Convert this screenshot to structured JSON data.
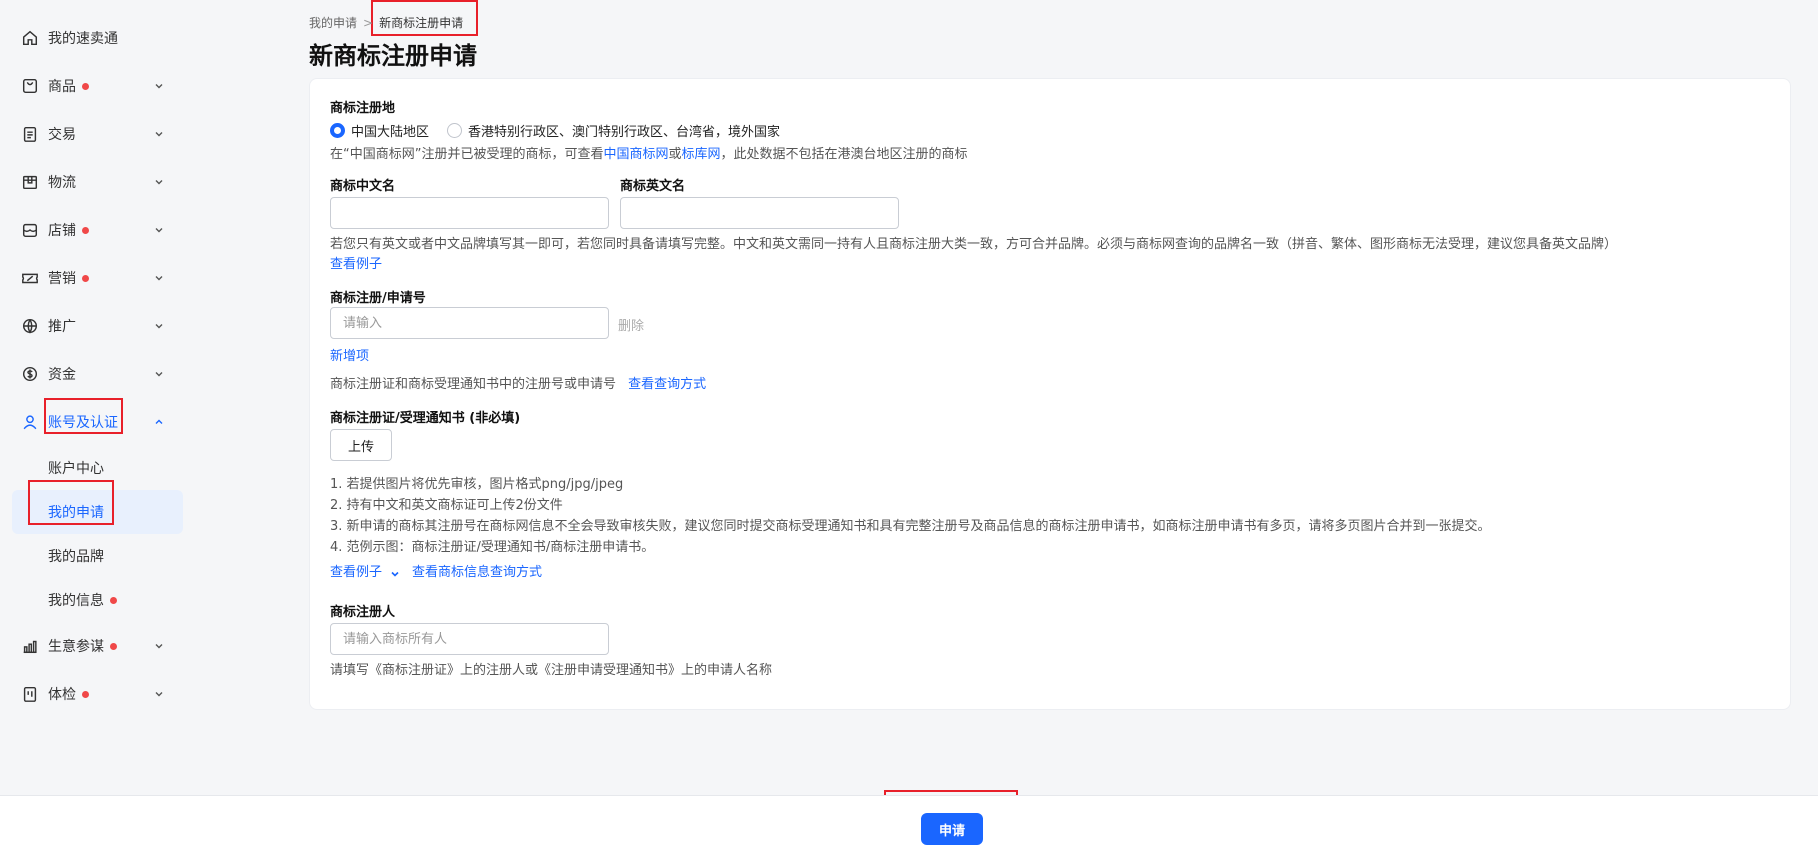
{
  "sidebar": {
    "items": [
      {
        "label": "我的速卖通",
        "icon": "home-icon",
        "dot": false,
        "chevron": false
      },
      {
        "label": "商品",
        "icon": "bag-icon",
        "dot": true,
        "chevron": true
      },
      {
        "label": "交易",
        "icon": "clipboard-icon",
        "dot": false,
        "chevron": true
      },
      {
        "label": "物流",
        "icon": "box-icon",
        "dot": false,
        "chevron": true
      },
      {
        "label": "店铺",
        "icon": "store-icon",
        "dot": true,
        "chevron": true
      },
      {
        "label": "营销",
        "icon": "ticket-icon",
        "dot": true,
        "chevron": true
      },
      {
        "label": "推广",
        "icon": "globe-icon",
        "dot": false,
        "chevron": true
      },
      {
        "label": "资金",
        "icon": "dollar-icon",
        "dot": false,
        "chevron": true
      },
      {
        "label": "账号及认证",
        "icon": "user-icon",
        "dot": false,
        "chevron": true,
        "expanded": true
      }
    ],
    "sub_items": [
      {
        "label": "账户中心",
        "dot": false
      },
      {
        "label": "我的申请",
        "dot": false,
        "selected": true
      },
      {
        "label": "我的品牌",
        "dot": false
      },
      {
        "label": "我的信息",
        "dot": true
      }
    ],
    "items_after": [
      {
        "label": "生意参谋",
        "icon": "chart-icon",
        "dot": true,
        "chevron": true
      },
      {
        "label": "体检",
        "icon": "report-icon",
        "dot": true,
        "chevron": true
      }
    ]
  },
  "breadcrumb": {
    "parent": "我的申请",
    "separator": ">",
    "current": "新商标注册申请"
  },
  "page_title": "新商标注册申请",
  "form": {
    "region": {
      "label": "商标注册地",
      "options": [
        "中国大陆地区",
        "香港特别行政区、澳门特别行政区、台湾省，境外国家"
      ],
      "selected_index": 0,
      "help_prefix": "在“中国商标网”注册并已被受理的商标，可查看",
      "help_link1": "中国商标网",
      "help_or": "或",
      "help_link2": "标库网",
      "help_suffix": "，此处数据不包括在港澳台地区注册的商标"
    },
    "cn_name": {
      "label": "商标中文名",
      "value": "",
      "placeholder": ""
    },
    "en_name": {
      "label": "商标英文名",
      "value": "",
      "placeholder": ""
    },
    "name_help": "若您只有英文或者中文品牌填写其一即可，若您同时具备请填写完整。中文和英文需同一持有人且商标注册大类一致，方可合并品牌。必须与商标网查询的品牌名一致（拼音、繁体、图形商标无法受理，建议您具备英文品牌）",
    "name_example_link": "查看例子",
    "reg_no": {
      "label": "商标注册/申请号",
      "placeholder": "请输入",
      "value": "",
      "delete_label": "删除",
      "add_label": "新增项",
      "help": "商标注册证和商标受理通知书中的注册号或申请号",
      "help_link": "查看查询方式"
    },
    "certificate": {
      "label": "商标注册证/受理通知书 (非必填)",
      "upload_label": "上传",
      "notes": [
        "1. 若提供图片将优先审核，图片格式png/jpg/jpeg",
        "2. 持有中文和英文商标证可上传2份文件",
        "3. 新申请的商标其注册号在商标网信息不全会导致审核失败，建议您同时提交商标受理通知书和具有完整注册号及商品信息的商标注册申请书，如商标注册申请书有多页，请将多页图片合并到一张提交。",
        "4. 范例示图：商标注册证/受理通知书/商标注册申请书。"
      ],
      "example_link": "查看例子",
      "query_link": "查看商标信息查询方式"
    },
    "registrant": {
      "label": "商标注册人",
      "placeholder": "请输入商标所有人",
      "value": "",
      "help": "请填写《商标注册证》上的注册人或《注册申请受理通知书》上的申请人名称"
    }
  },
  "footer": {
    "submit_label": "申请"
  },
  "colors": {
    "accent": "#1a66ff",
    "dot": "#f04848",
    "highlight_box": "#e8202a"
  }
}
